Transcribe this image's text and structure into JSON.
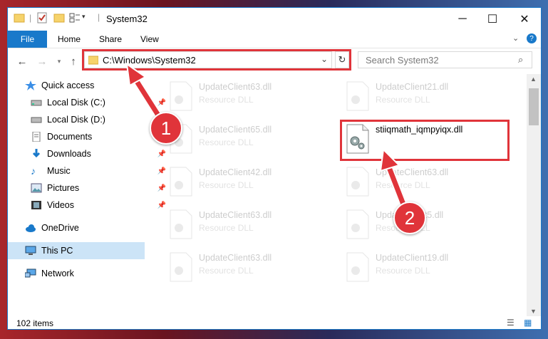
{
  "window": {
    "title": "System32"
  },
  "ribbon": {
    "file": "File",
    "tabs": [
      "Home",
      "Share",
      "View"
    ]
  },
  "address": {
    "path": "C:\\Windows\\System32",
    "search_placeholder": "Search System32"
  },
  "sidebar": {
    "items": [
      {
        "label": "Quick access",
        "icon": "star-icon",
        "pinned": false
      },
      {
        "label": "Local Disk (C:)",
        "icon": "drive-icon",
        "pinned": true
      },
      {
        "label": "Local Disk (D:)",
        "icon": "drive-icon",
        "pinned": true
      },
      {
        "label": "Documents",
        "icon": "documents-icon",
        "pinned": true
      },
      {
        "label": "Downloads",
        "icon": "downloads-icon",
        "pinned": true
      },
      {
        "label": "Music",
        "icon": "music-icon",
        "pinned": true
      },
      {
        "label": "Pictures",
        "icon": "pictures-icon",
        "pinned": true
      },
      {
        "label": "Videos",
        "icon": "videos-icon",
        "pinned": true
      },
      {
        "label": "OneDrive",
        "icon": "cloud-icon",
        "pinned": false
      },
      {
        "label": "This PC",
        "icon": "computer-icon",
        "pinned": false,
        "selected": true
      },
      {
        "label": "Network",
        "icon": "network-icon",
        "pinned": false
      }
    ]
  },
  "files": {
    "left": [
      {
        "name": "UpdateClient63.dll",
        "type": "Resource DLL"
      },
      {
        "name": "UpdateClient65.dll",
        "type": "Resource DLL"
      },
      {
        "name": "UpdateClient42.dll",
        "type": "Resource DLL"
      },
      {
        "name": "UpdateClient63.dll",
        "type": "Resource DLL"
      },
      {
        "name": "UpdateClient63.dll",
        "type": "Resource DLL"
      }
    ],
    "right": [
      {
        "name": "UpdateClient21.dll",
        "type": "Resource DLL"
      },
      {
        "name": "stiiqmath_iqmpyiqx.dll",
        "type": ""
      },
      {
        "name": "UpdateClient63.dll",
        "type": "Resource DLL"
      },
      {
        "name": "UpdateClient5.dll",
        "type": "Resource DLL"
      },
      {
        "name": "UpdateClient19.dll",
        "type": "Resource DLL"
      }
    ]
  },
  "status": {
    "count": "102 items"
  },
  "callouts": [
    "1",
    "2"
  ],
  "colors": {
    "accent": "#1979ca",
    "highlight": "#e0343a"
  }
}
